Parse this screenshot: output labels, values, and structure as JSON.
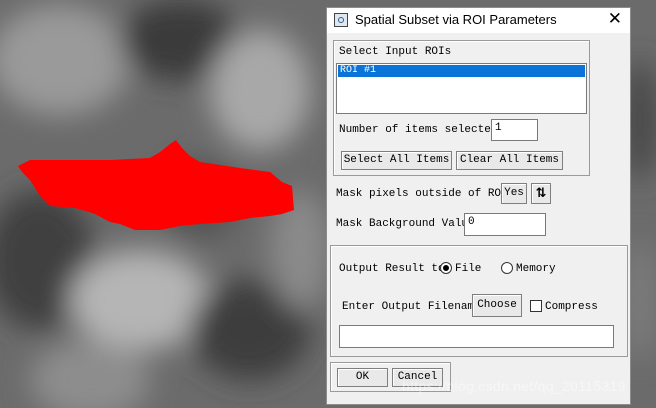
{
  "dialog": {
    "title": "Spatial Subset via ROI Parameters",
    "close_glyph": "✕"
  },
  "roi_section": {
    "header": "Select Input ROIs",
    "items": [
      "ROI #1"
    ],
    "selected_count_label": "Number of items selected:",
    "selected_count_value": "1",
    "select_all_label": "Select All Items",
    "clear_all_label": "Clear All Items"
  },
  "mask": {
    "outside_label": "Mask pixels outside of ROI?",
    "outside_value": "Yes",
    "toggle_glyph": "⇅",
    "background_label": "Mask Background Value",
    "background_value": "0"
  },
  "output": {
    "result_label": "Output Result to",
    "file_label": "File",
    "memory_label": "Memory",
    "selected": "File",
    "filename_label": "Enter Output Filename",
    "choose_label": "Choose",
    "compress_label": "Compress",
    "filename_value": ""
  },
  "footer": {
    "ok_label": "OK",
    "cancel_label": "Cancel"
  },
  "watermark": "https://blog.csdn.net/qq_20115319",
  "colors": {
    "roi_fill": "#ff0000",
    "selection": "#0a74d8"
  }
}
